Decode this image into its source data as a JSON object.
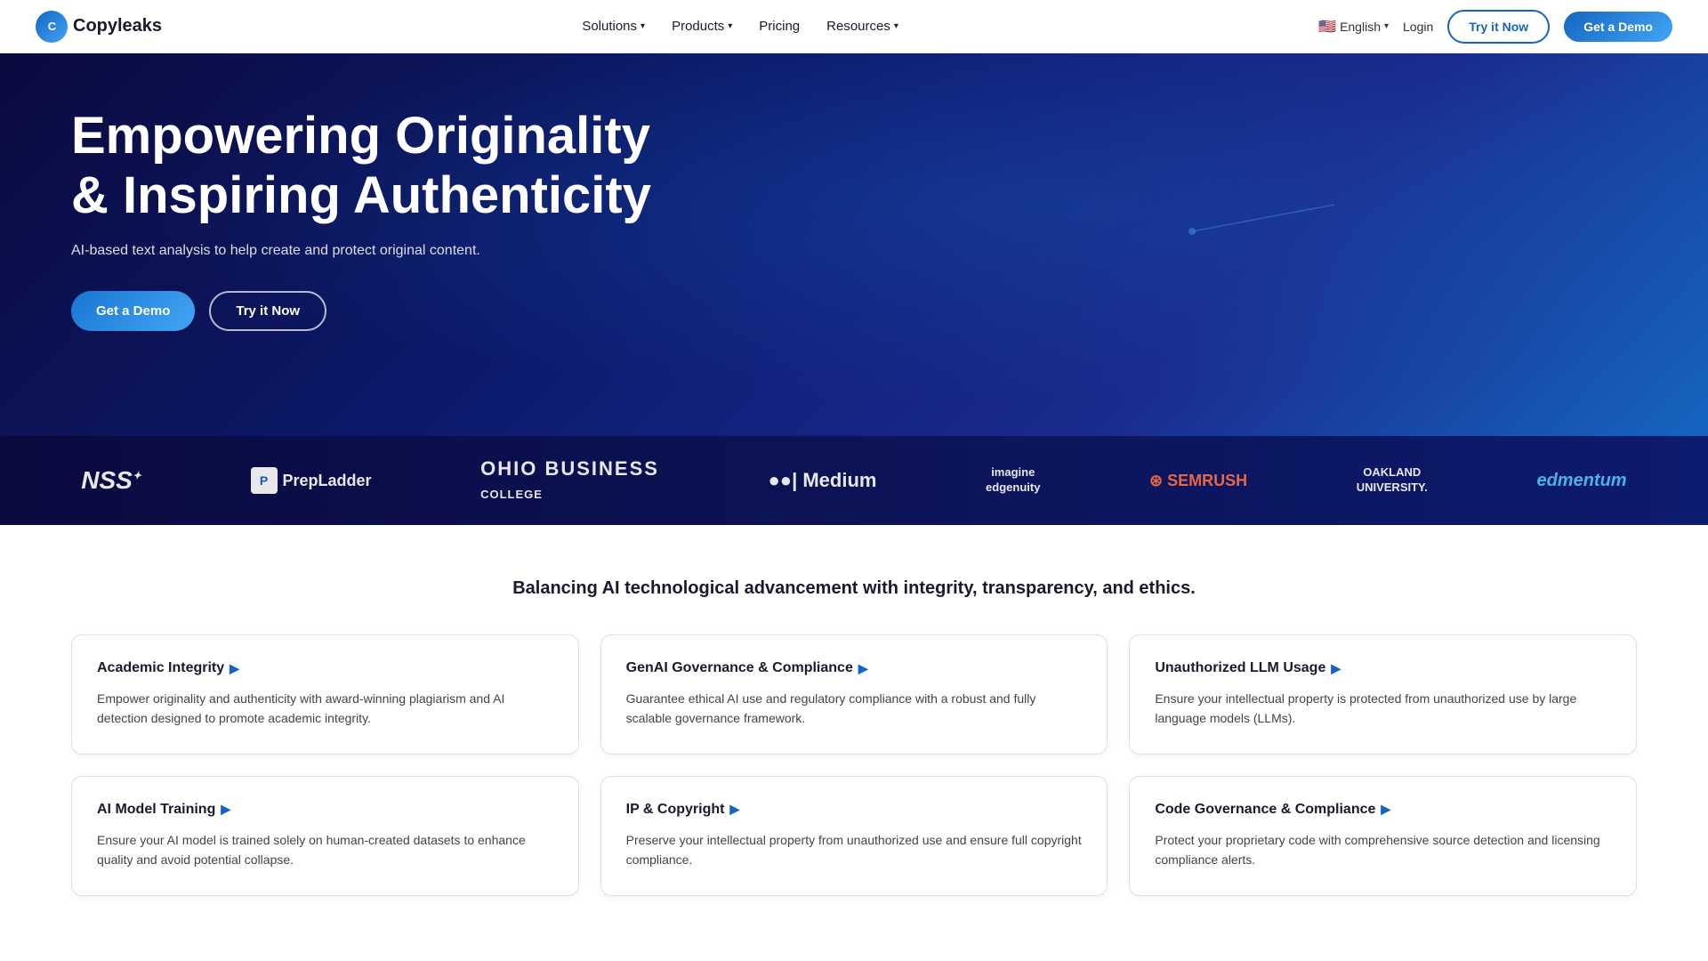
{
  "nav": {
    "logo": {
      "icon": "C",
      "text": "Copyleaks"
    },
    "links": [
      {
        "label": "Solutions",
        "hasDropdown": true
      },
      {
        "label": "Products",
        "hasDropdown": true
      },
      {
        "label": "Pricing",
        "hasDropdown": false
      },
      {
        "label": "Resources",
        "hasDropdown": true
      }
    ],
    "lang": {
      "flag": "🇺🇸",
      "text": "English"
    },
    "login": "Login",
    "try_btn": "Try it Now",
    "demo_btn": "Get a Demo"
  },
  "hero": {
    "heading_line1": "Empowering Originality",
    "heading_line2": "& Inspiring Authenticity",
    "subtext": "AI-based text analysis to help create and protect original content.",
    "btn_demo": "Get a Demo",
    "btn_try": "Try it Now"
  },
  "logos": [
    {
      "id": "nss",
      "text": "NSS"
    },
    {
      "id": "prepladder",
      "text": "PrepLadder"
    },
    {
      "id": "ohio",
      "text": "OHIO BUSINESS COLLEGE"
    },
    {
      "id": "medium",
      "text": "●●| Medium"
    },
    {
      "id": "imagine",
      "text": "imagine\nedgenuity"
    },
    {
      "id": "semrush",
      "text": "⊙ SEMRUSH"
    },
    {
      "id": "oakland",
      "text": "OAKLAND\nUNIVERSITY"
    },
    {
      "id": "edmentum",
      "text": "edmentum"
    }
  ],
  "main": {
    "tagline": "Balancing AI technological advancement with integrity, transparency, and ethics.",
    "cards": [
      {
        "id": "academic-integrity",
        "title": "Academic Integrity",
        "description": "Empower originality and authenticity with award-winning plagiarism and AI detection designed to promote academic integrity."
      },
      {
        "id": "genai-governance",
        "title": "GenAI Governance & Compliance",
        "description": "Guarantee ethical AI use and regulatory compliance with a robust and fully scalable governance framework."
      },
      {
        "id": "unauthorized-llm",
        "title": "Unauthorized LLM Usage",
        "description": "Ensure your intellectual property is protected from unauthorized use by large language models (LLMs)."
      },
      {
        "id": "ai-model-training",
        "title": "AI Model Training",
        "description": "Ensure your AI model is trained solely on human-created datasets to enhance quality and avoid potential collapse."
      },
      {
        "id": "ip-copyright",
        "title": "IP & Copyright",
        "description": "Preserve your intellectual property from unauthorized use and ensure full copyright compliance."
      },
      {
        "id": "code-governance",
        "title": "Code Governance & Compliance",
        "description": "Protect your proprietary code with comprehensive source detection and licensing compliance alerts."
      }
    ]
  }
}
